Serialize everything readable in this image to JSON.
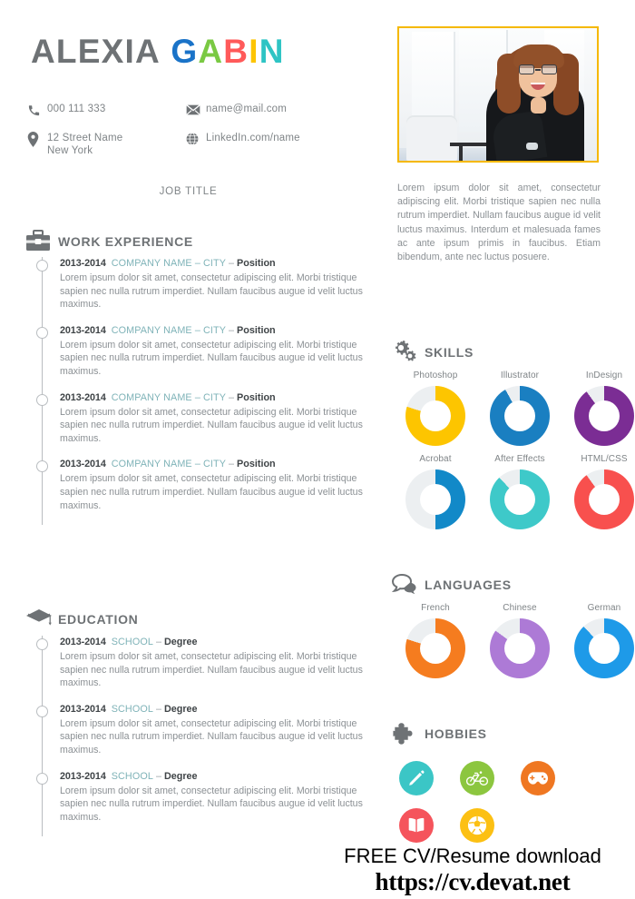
{
  "header": {
    "name_first": "ALEXIA",
    "name_last_letters": [
      {
        "ch": "G",
        "color": "#1a73c8"
      },
      {
        "ch": "A",
        "color": "#7ac943"
      },
      {
        "ch": "B",
        "color": "#ff5a5a"
      },
      {
        "ch": "I",
        "color": "#fdc400"
      },
      {
        "ch": "N",
        "color": "#2ec4c4"
      }
    ],
    "job_title": "JOB TITLE",
    "contacts": [
      {
        "icon": "phone-icon",
        "text": "000 111 333"
      },
      {
        "icon": "envelope-icon",
        "text": "name@mail.com"
      },
      {
        "icon": "location-pin-icon",
        "text": "12 Street Name\nNew York"
      },
      {
        "icon": "globe-icon",
        "text": "LinkedIn.com/name"
      }
    ]
  },
  "photo": {
    "alt": "portrait-photo",
    "border_color": "#f5b800"
  },
  "profile": {
    "text": "Lorem ipsum dolor sit amet, consectetur adipiscing elit. Morbi tristique sapien nec nulla rutrum imperdiet. Nullam faucibus augue id velit luctus maximus. Interdum et malesuada fames ac ante ipsum primis in faucibus. Etiam bibendum, ante nec luctus posuere."
  },
  "work": {
    "title": "WORK EXPERIENCE",
    "icon": "briefcase-icon",
    "entries": [
      {
        "years": "2013-2014",
        "org": "COMPANY NAME – CITY",
        "dash": "–",
        "role": "Position",
        "desc": "Lorem ipsum dolor sit amet, consectetur adipiscing elit. Morbi tristique sapien nec nulla rutrum imperdiet. Nullam faucibus augue id velit luctus maximus."
      },
      {
        "years": "2013-2014",
        "org": "COMPANY NAME – CITY",
        "dash": "–",
        "role": "Position",
        "desc": "Lorem ipsum dolor sit amet, consectetur adipiscing elit. Morbi tristique sapien nec nulla rutrum imperdiet. Nullam faucibus augue id velit luctus maximus."
      },
      {
        "years": "2013-2014",
        "org": "COMPANY NAME – CITY",
        "dash": "–",
        "role": "Position",
        "desc": "Lorem ipsum dolor sit amet, consectetur adipiscing elit. Morbi tristique sapien nec nulla rutrum imperdiet. Nullam faucibus augue id velit luctus maximus."
      },
      {
        "years": "2013-2014",
        "org": "COMPANY NAME – CITY",
        "dash": "–",
        "role": "Position",
        "desc": "Lorem ipsum dolor sit amet, consectetur adipiscing elit. Morbi tristique sapien nec nulla rutrum imperdiet. Nullam faucibus augue id velit luctus maximus."
      }
    ]
  },
  "education": {
    "title": "EDUCATION",
    "icon": "graduation-cap-icon",
    "entries": [
      {
        "years": "2013-2014",
        "org": "SCHOOL",
        "dash": "–",
        "role": "Degree",
        "desc": "Lorem ipsum dolor sit amet, consectetur adipiscing elit. Morbi tristique sapien nec nulla rutrum imperdiet. Nullam faucibus augue id velit luctus maximus."
      },
      {
        "years": "2013-2014",
        "org": "SCHOOL",
        "dash": "–",
        "role": "Degree",
        "desc": "Lorem ipsum dolor sit amet, consectetur adipiscing elit. Morbi tristique sapien nec nulla rutrum imperdiet. Nullam faucibus augue id velit luctus maximus."
      },
      {
        "years": "2013-2014",
        "org": "SCHOOL",
        "dash": "–",
        "role": "Degree",
        "desc": "Lorem ipsum dolor sit amet, consectetur adipiscing elit. Morbi tristique sapien nec nulla rutrum imperdiet. Nullam faucibus augue id velit luctus maximus."
      }
    ]
  },
  "skills": {
    "title": "SKILLS",
    "icon": "gears-icon",
    "track_color": "#eceff1",
    "items": [
      {
        "label": "Photoshop",
        "percent": 80,
        "color": "#fdc500"
      },
      {
        "label": "Illustrator",
        "percent": 92,
        "color": "#1a7fc1"
      },
      {
        "label": "InDesign",
        "percent": 90,
        "color": "#7b2d94"
      },
      {
        "label": "Acrobat",
        "percent": 50,
        "color": "#1289c8"
      },
      {
        "label": "After Effects",
        "percent": 88,
        "color": "#3ec9c9"
      },
      {
        "label": "HTML/CSS",
        "percent": 90,
        "color": "#f8504e"
      }
    ]
  },
  "languages": {
    "title": "LANGUAGES",
    "icon": "speech-bubbles-icon",
    "track_color": "#eceff1",
    "items": [
      {
        "label": "French",
        "percent": 80,
        "color": "#f57c1f"
      },
      {
        "label": "Chinese",
        "percent": 85,
        "color": "#ad7ad6"
      },
      {
        "label": "German",
        "percent": 88,
        "color": "#1e9ae8"
      }
    ]
  },
  "hobbies": {
    "title": "HOBBIES",
    "icon": "puzzle-piece-icon",
    "items": [
      {
        "icon": "pencil-icon",
        "color": "#3bc6c6"
      },
      {
        "icon": "bicycle-icon",
        "color": "#8cc63f"
      },
      {
        "icon": "gamepad-icon",
        "color": "#ef7722"
      },
      {
        "icon": "book-icon",
        "color": "#f5545c"
      },
      {
        "icon": "soccer-ball-icon",
        "color": "#fcc013"
      }
    ]
  },
  "chart_data": [
    {
      "type": "pie",
      "title": "SKILLS",
      "categories": [
        "Photoshop",
        "Illustrator",
        "InDesign",
        "Acrobat",
        "After Effects",
        "HTML/CSS"
      ],
      "values": [
        80,
        92,
        90,
        50,
        88,
        90
      ],
      "ylim": [
        0,
        100
      ],
      "colors": [
        "#fdc500",
        "#1a7fc1",
        "#7b2d94",
        "#1289c8",
        "#3ec9c9",
        "#f8504e"
      ],
      "xlabel": "",
      "ylabel": "",
      "legend": "none",
      "grid": false
    },
    {
      "type": "pie",
      "title": "LANGUAGES",
      "categories": [
        "French",
        "Chinese",
        "German"
      ],
      "values": [
        80,
        85,
        88
      ],
      "ylim": [
        0,
        100
      ],
      "colors": [
        "#f57c1f",
        "#ad7ad6",
        "#1e9ae8"
      ],
      "xlabel": "",
      "ylabel": "",
      "legend": "none",
      "grid": false
    }
  ],
  "watermark": {
    "line1": "FREE CV/Resume download",
    "line2": "https://cv.devat.net"
  }
}
